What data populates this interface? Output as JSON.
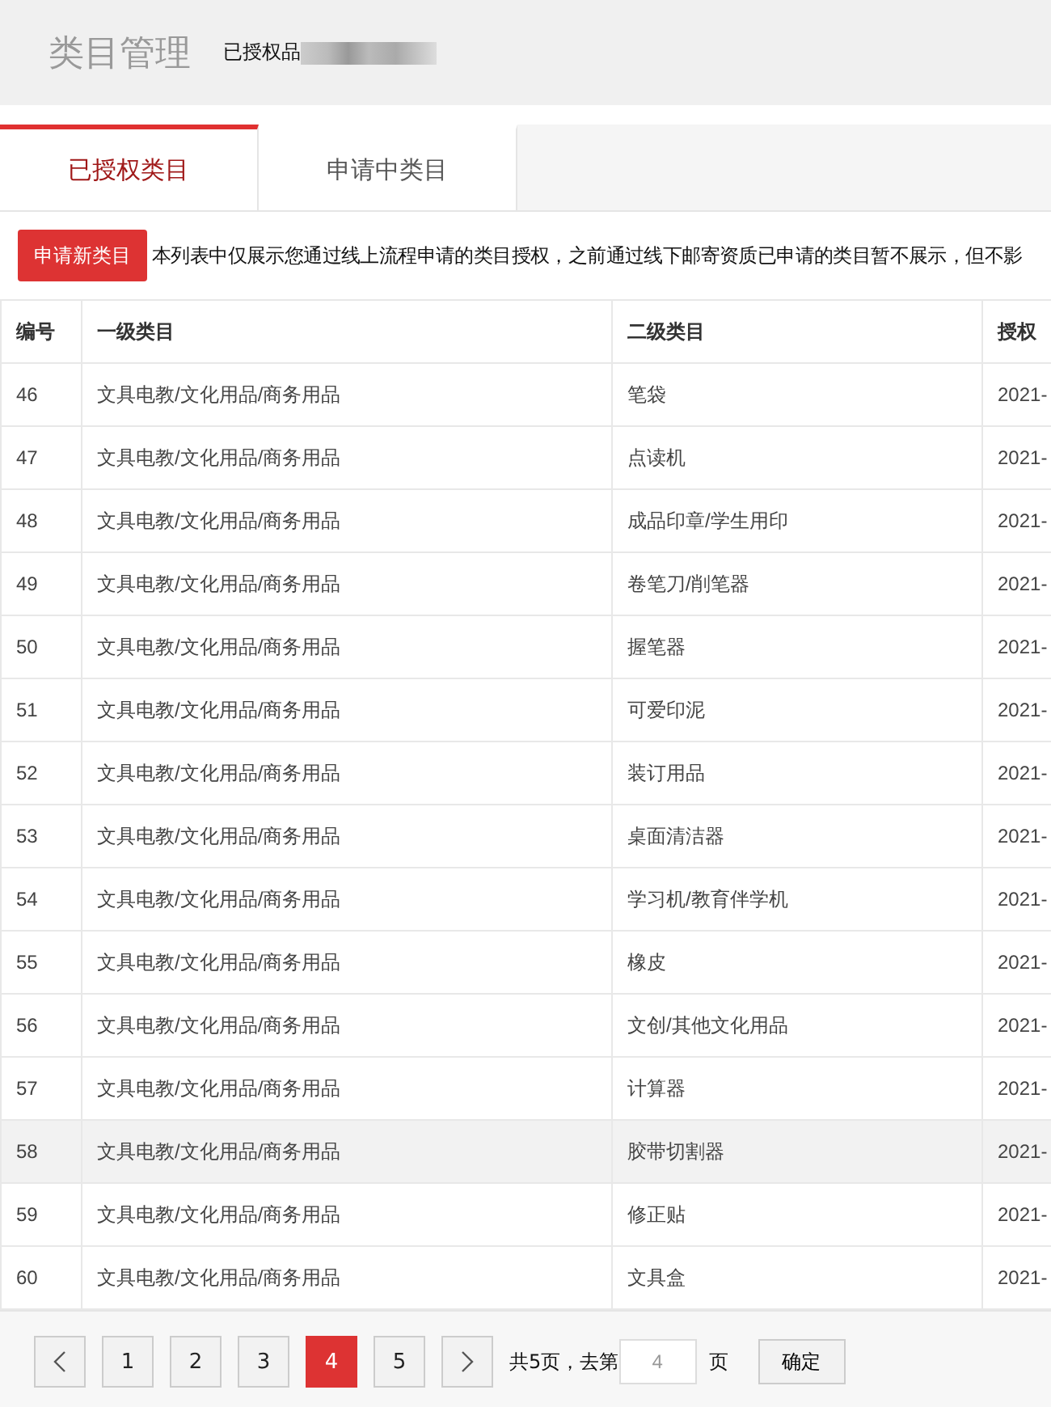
{
  "header": {
    "title": "类目管理",
    "subtitle": "已授权品"
  },
  "tabs": [
    {
      "label": "已授权类目",
      "selected": true
    },
    {
      "label": "申请中类目",
      "selected": false
    }
  ],
  "toolbar": {
    "button": "申请新类目",
    "notice": "本列表中仅展示您通过线上流程申请的类目授权，之前通过线下邮寄资质已申请的类目暂不展示，但不影"
  },
  "table": {
    "columns": [
      "编号",
      "一级类目",
      "二级类目",
      "授权"
    ],
    "rows": [
      {
        "cells": [
          "46",
          "文具电教/文化用品/商务用品",
          "笔袋",
          "2021-"
        ],
        "highlighted": false
      },
      {
        "cells": [
          "47",
          "文具电教/文化用品/商务用品",
          "点读机",
          "2021-"
        ],
        "highlighted": false
      },
      {
        "cells": [
          "48",
          "文具电教/文化用品/商务用品",
          "成品印章/学生用印",
          "2021-"
        ],
        "highlighted": false
      },
      {
        "cells": [
          "49",
          "文具电教/文化用品/商务用品",
          "卷笔刀/削笔器",
          "2021-"
        ],
        "highlighted": false
      },
      {
        "cells": [
          "50",
          "文具电教/文化用品/商务用品",
          "握笔器",
          "2021-"
        ],
        "highlighted": false
      },
      {
        "cells": [
          "51",
          "文具电教/文化用品/商务用品",
          "可爱印泥",
          "2021-"
        ],
        "highlighted": false
      },
      {
        "cells": [
          "52",
          "文具电教/文化用品/商务用品",
          "装订用品",
          "2021-"
        ],
        "highlighted": false
      },
      {
        "cells": [
          "53",
          "文具电教/文化用品/商务用品",
          "桌面清洁器",
          "2021-"
        ],
        "highlighted": false
      },
      {
        "cells": [
          "54",
          "文具电教/文化用品/商务用品",
          "学习机/教育伴学机",
          "2021-"
        ],
        "highlighted": false
      },
      {
        "cells": [
          "55",
          "文具电教/文化用品/商务用品",
          "橡皮",
          "2021-"
        ],
        "highlighted": false
      },
      {
        "cells": [
          "56",
          "文具电教/文化用品/商务用品",
          "文创/其他文化用品",
          "2021-"
        ],
        "highlighted": false
      },
      {
        "cells": [
          "57",
          "文具电教/文化用品/商务用品",
          "计算器",
          "2021-"
        ],
        "highlighted": false
      },
      {
        "cells": [
          "58",
          "文具电教/文化用品/商务用品",
          "胶带切割器",
          "2021-"
        ],
        "highlighted": true
      },
      {
        "cells": [
          "59",
          "文具电教/文化用品/商务用品",
          "修正贴",
          "2021-"
        ],
        "highlighted": false
      },
      {
        "cells": [
          "60",
          "文具电教/文化用品/商务用品",
          "文具盒",
          "2021-"
        ],
        "highlighted": false
      }
    ]
  },
  "pagination": {
    "pages": [
      {
        "label": "1",
        "selected": false
      },
      {
        "label": "2",
        "selected": false
      },
      {
        "label": "3",
        "selected": false
      },
      {
        "label": "4",
        "selected": true
      },
      {
        "label": "5",
        "selected": false
      }
    ],
    "total": "共5页，去第",
    "input": "4",
    "suffix": "页",
    "confirm": "确定"
  }
}
